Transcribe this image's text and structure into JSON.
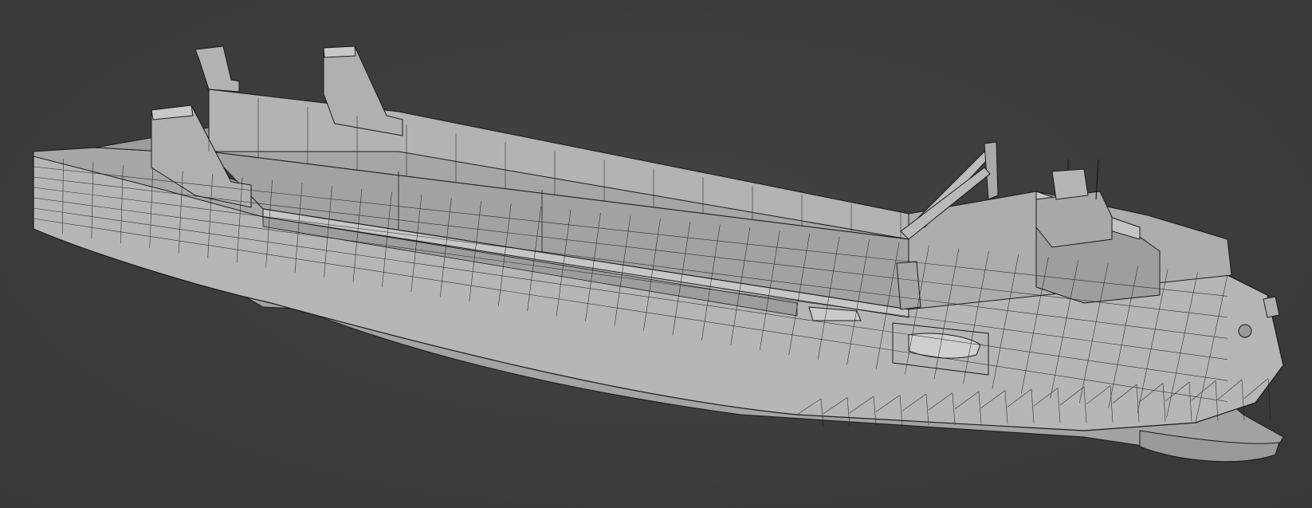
{
  "viewport": {
    "background": "#3d3d3d",
    "shading": "solid",
    "overlay": "wireframe",
    "subject": "ship-hull-model"
  },
  "colors": {
    "hull_light": "#bdbdbd",
    "hull_mid": "#a9a9a9",
    "hull_dark": "#8f8f8f",
    "deck": "#a4a4a4",
    "wire": "#1a1a1a"
  }
}
